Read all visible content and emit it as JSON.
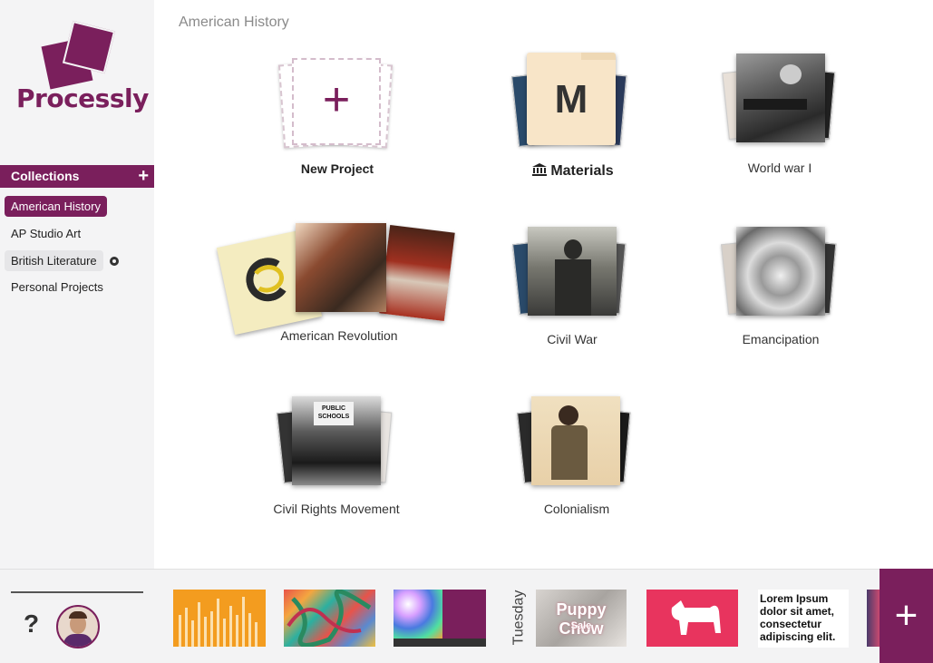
{
  "app": {
    "name": "Processly"
  },
  "sidebar": {
    "collections_label": "Collections",
    "collections_add": "+",
    "items": [
      {
        "label": "American History",
        "active": true
      },
      {
        "label": "AP Studio Art"
      },
      {
        "label": "British Literature",
        "hovered": true
      },
      {
        "label": "Personal Projects"
      }
    ]
  },
  "breadcrumb": "American History",
  "tiles": {
    "new_project": {
      "label": "New Project",
      "icon": "+"
    },
    "materials": {
      "label": "Materials",
      "letter": "M"
    },
    "world_war_1": {
      "label": "World war I"
    },
    "american_revolution": {
      "label": "American Revolution"
    },
    "civil_war": {
      "label": "Civil War"
    },
    "emancipation": {
      "label": "Emancipation"
    },
    "civil_rights": {
      "label": "Civil Rights Movement",
      "sign_text": "PUBLIC SCHOOLS"
    },
    "colonialism": {
      "label": "Colonialism"
    }
  },
  "bottom": {
    "help": "?",
    "day_label": "Tuesday",
    "puppy_text": "Puppy Chow",
    "puppy_sub": "Sale",
    "lorem": "Lorem Ipsum dolor sit amet, consectetur adipiscing elit.",
    "fab": "+"
  },
  "colors": {
    "brand": "#7a1f5c",
    "accent_orange": "#f39c1f",
    "accent_pink": "#e8345e"
  }
}
